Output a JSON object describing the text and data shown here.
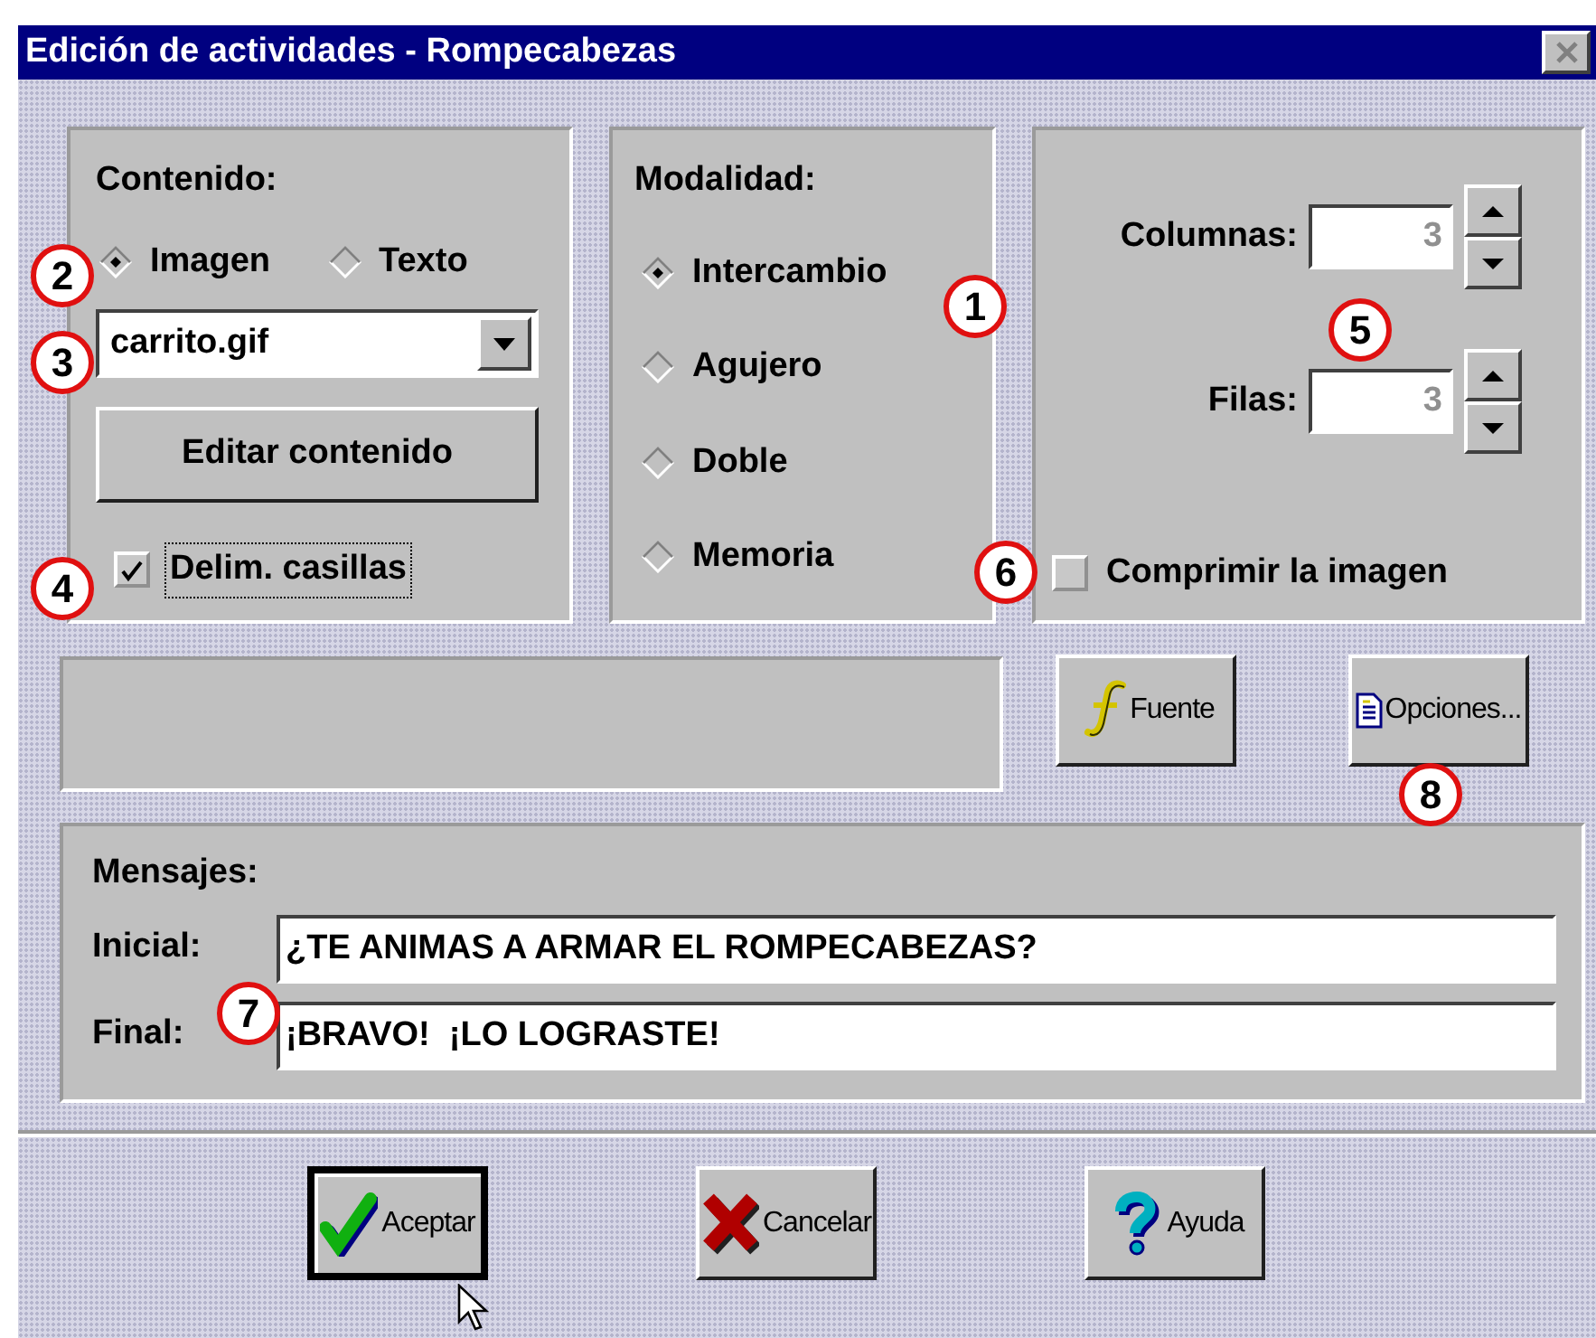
{
  "window": {
    "title": "Edición de actividades - Rompecabezas"
  },
  "contenido": {
    "label": "Contenido:",
    "options": [
      {
        "label": "Imagen",
        "selected": true
      },
      {
        "label": "Texto",
        "selected": false
      }
    ],
    "file": {
      "value": "carrito.gif"
    },
    "edit_button": "Editar contenido",
    "delim": {
      "label": "Delim. casillas",
      "checked": true,
      "focused": true
    }
  },
  "modalidad": {
    "label": "Modalidad:",
    "options": [
      {
        "label": "Intercambio",
        "selected": true
      },
      {
        "label": "Agujero",
        "selected": false
      },
      {
        "label": "Doble",
        "selected": false
      },
      {
        "label": "Memoria",
        "selected": false
      }
    ]
  },
  "grid": {
    "fields": [
      {
        "label": "Columnas:",
        "value": "3",
        "disabled": true
      },
      {
        "label": "Filas:",
        "value": "3",
        "disabled": true
      }
    ],
    "compress": {
      "label": "Comprimir la imagen",
      "checked": false
    }
  },
  "tool_buttons": [
    {
      "label": "Fuente",
      "kind": "font"
    },
    {
      "label": "Opciones...",
      "kind": "document"
    }
  ],
  "mensajes": {
    "label": "Mensajes:",
    "fields": [
      {
        "label": "Inicial:",
        "value": "¿TE ANIMAS A ARMAR EL ROMPECABEZAS?"
      },
      {
        "label": "Final:",
        "value": "¡BRAVO!  ¡LO LOGRASTE!"
      }
    ]
  },
  "buttons": [
    {
      "label": "Aceptar",
      "kind": "accept",
      "default": true
    },
    {
      "label": "Cancelar",
      "kind": "cancel",
      "default": false
    },
    {
      "label": "Ayuda",
      "kind": "help",
      "default": false
    }
  ],
  "callouts": [
    "1",
    "2",
    "3",
    "4",
    "5",
    "6",
    "7",
    "8"
  ]
}
